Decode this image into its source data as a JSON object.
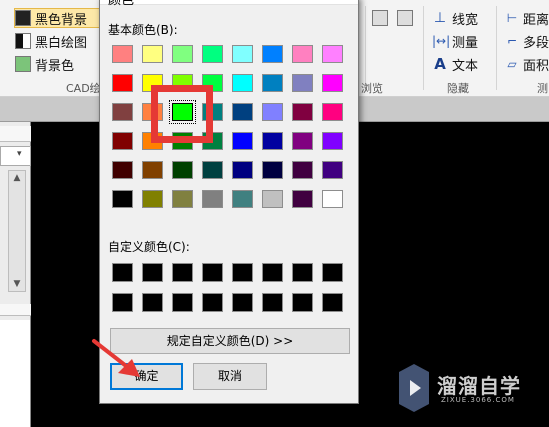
{
  "ribbon": {
    "bg_items": [
      "黑色背景",
      "黑白绘图",
      "背景色"
    ],
    "group_cad_label": "CAD绘",
    "group_browse_label": "浏览",
    "annot_items": [
      "线宽",
      "测量",
      "文本"
    ],
    "group_hide_label": "隐藏",
    "measure_items": [
      "距离",
      "多段",
      "面积"
    ],
    "group_measure_label": "测"
  },
  "dialog": {
    "title": "颜色",
    "basic_colors_label": "基本颜色(B):",
    "custom_colors_label": "自定义颜色(C):",
    "define_custom_button": "规定自定义颜色(D) >>",
    "ok_button": "确定",
    "cancel_button": "取消",
    "selected_color": "#00ff00",
    "basic_colors": [
      [
        "#ff8080",
        "#ffff80",
        "#80ff80",
        "#00ff80",
        "#80ffff",
        "#0080ff",
        "#ff80c0",
        "#ff80ff"
      ],
      [
        "#ff0000",
        "#ffff00",
        "#80ff00",
        "#00ff40",
        "#00ffff",
        "#0080c0",
        "#8080c0",
        "#ff00ff"
      ],
      [
        "#804040",
        "#ff8040",
        "#00ff00",
        "#008080",
        "#004080",
        "#8080ff",
        "#800040",
        "#ff0080"
      ],
      [
        "#800000",
        "#ff8000",
        "#008000",
        "#008040",
        "#0000ff",
        "#0000a0",
        "#800080",
        "#8000ff"
      ],
      [
        "#400000",
        "#804000",
        "#004000",
        "#004040",
        "#000080",
        "#000040",
        "#400040",
        "#400080"
      ],
      [
        "#000000",
        "#808000",
        "#808040",
        "#808080",
        "#408080",
        "#c0c0c0",
        "#400040",
        "#ffffff"
      ]
    ],
    "custom_colors": [
      [
        "#000000",
        "#000000",
        "#000000",
        "#000000",
        "#000000",
        "#000000",
        "#000000",
        "#000000"
      ],
      [
        "#000000",
        "#000000",
        "#000000",
        "#000000",
        "#000000",
        "#000000",
        "#000000",
        "#000000"
      ]
    ]
  },
  "annotation_color": "#e53935",
  "watermark": {
    "text": "溜溜自学",
    "url": "ZIXUE.3066.COM"
  }
}
